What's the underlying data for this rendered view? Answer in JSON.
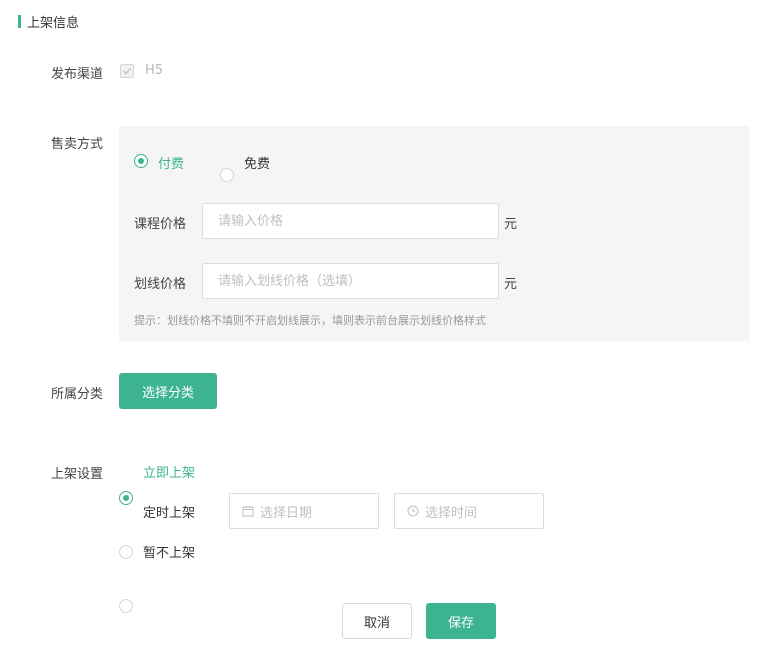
{
  "section": {
    "title": "上架信息"
  },
  "channel": {
    "label": "发布渠道",
    "option": "H5",
    "checked": true
  },
  "sale": {
    "label": "售卖方式",
    "options": [
      {
        "label": "付费",
        "checked": true
      },
      {
        "label": "免费",
        "checked": false
      }
    ],
    "price": {
      "label": "课程价格",
      "placeholder": "请输入价格",
      "unit": "元"
    },
    "strike_price": {
      "label": "划线价格",
      "placeholder": "请输入划线价格（选填）",
      "unit": "元"
    },
    "hint": "提示：划线价格不填则不开启划线展示，填则表示前台展示划线价格样式"
  },
  "category": {
    "label": "所属分类",
    "button": "选择分类"
  },
  "listing": {
    "label": "上架设置",
    "options": [
      {
        "label": "立即上架",
        "checked": true
      },
      {
        "label": "定时上架",
        "checked": false
      },
      {
        "label": "暂不上架",
        "checked": false
      }
    ],
    "date_placeholder": "选择日期",
    "time_placeholder": "选择时间"
  },
  "actions": {
    "cancel": "取消",
    "save": "保存"
  },
  "colors": {
    "accent": "#3cb492",
    "panel_bg": "#f5f5f5",
    "hint": "#999999"
  }
}
